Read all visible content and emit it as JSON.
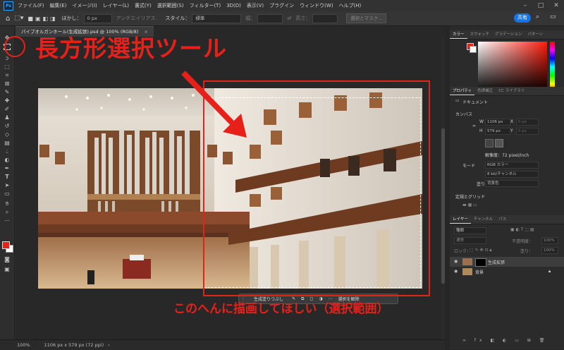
{
  "menu": {
    "app_icon": "Ps",
    "items": [
      "ファイル(F)",
      "編集(E)",
      "イメージ(I)",
      "レイヤー(L)",
      "書式(Y)",
      "選択範囲(S)",
      "フィルター(T)",
      "3D(D)",
      "表示(V)",
      "プラグイン",
      "ウィンドウ(W)",
      "ヘルプ(H)"
    ]
  },
  "options": {
    "feather_label": "ぼかし：",
    "feather_value": "0 px",
    "antialias": "アンチエイリアス",
    "style_label": "スタイル：",
    "style_value": "標準",
    "width_label": "幅：",
    "height_label": "高さ：",
    "select_mask": "選択とマスク..."
  },
  "share_label": "共有",
  "document": {
    "tab_title": "パイプオルガンホール(生成拡張).psd @ 100% (RGB/8)"
  },
  "status": {
    "zoom": "100%",
    "dimensions": "1106 px x 579 px (72 ppi)"
  },
  "color_panel": {
    "tabs": [
      "カラー",
      "スウォッチ",
      "グラデーション",
      "パターン"
    ],
    "foreground": "#e8201a",
    "background": "#ffffff"
  },
  "properties": {
    "tabs": [
      "プロパティ",
      "色調補正",
      "CC ライブラリ"
    ],
    "doc_label": "ドキュメント",
    "canvas_header": "カンバス",
    "w_label": "W",
    "w_value": "1106 px",
    "h_label": "H",
    "h_value": "579 px",
    "x_label": "X",
    "x_value": "0 px",
    "y_label": "Y",
    "y_value": "0 px",
    "resolution": "解像度：72 pixel/inch",
    "mode_label": "モード",
    "mode_value": "RGB カラー",
    "depth_value": "8 bit/チャンネル",
    "fill_label": "塗り",
    "fill_value": "背景色",
    "rulers_header": "定規とグリッド"
  },
  "layers": {
    "tabs": [
      "レイヤー",
      "チャンネル",
      "パス"
    ],
    "kind": "種類",
    "blend_mode": "通常",
    "opacity_label": "不透明度：",
    "opacity_value": "100%",
    "lock_label": "ロック：",
    "fill_label": "塗り：",
    "fill_value": "100%",
    "items": [
      {
        "name": "生成拡張"
      },
      {
        "name": "背景"
      }
    ]
  },
  "taskbar": {
    "generative_fill": "生成塗りつぶし",
    "deselect": "選択を解除"
  },
  "annotations": {
    "title": "長方形選択ツール",
    "note": "このへんに描画してほしい（選択範囲）"
  }
}
